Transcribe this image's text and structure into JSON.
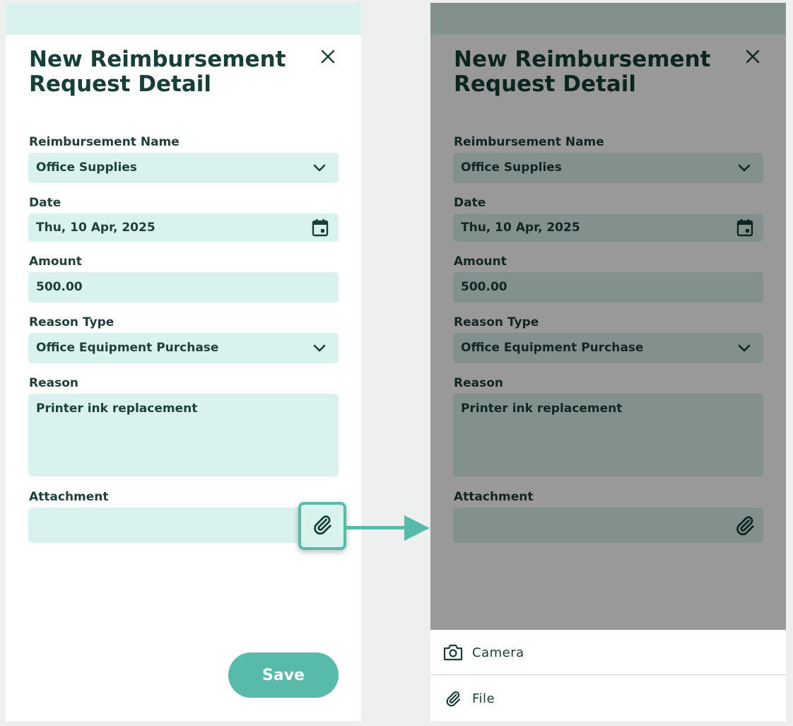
{
  "form": {
    "title_line1": "New Reimbursement",
    "title_line2": "Request Detail",
    "fields": {
      "reimbursement_name": {
        "label": "Reimbursement Name",
        "value": "Office Supplies"
      },
      "date": {
        "label": "Date",
        "value": "Thu, 10 Apr, 2025"
      },
      "amount": {
        "label": "Amount",
        "value": "500.00"
      },
      "reason_type": {
        "label": "Reason Type",
        "value": "Office Equipment Purchase"
      },
      "reason": {
        "label": "Reason",
        "value": "Printer ink replacement"
      },
      "attachment": {
        "label": "Attachment",
        "value": ""
      }
    },
    "save_label": "Save"
  },
  "sheet": {
    "items": [
      {
        "label": "Camera",
        "icon": "camera-icon"
      },
      {
        "label": "File",
        "icon": "paperclip-icon"
      }
    ]
  },
  "colors": {
    "accent": "#58bba9",
    "field_bg": "#d9f2ed",
    "text_dark": "#173f38",
    "overlay": "rgba(0,0,0,0.4)"
  },
  "icons": [
    "close-icon",
    "chevron-down-icon",
    "calendar-icon",
    "paperclip-icon",
    "camera-icon",
    "arrow-right-icon"
  ]
}
